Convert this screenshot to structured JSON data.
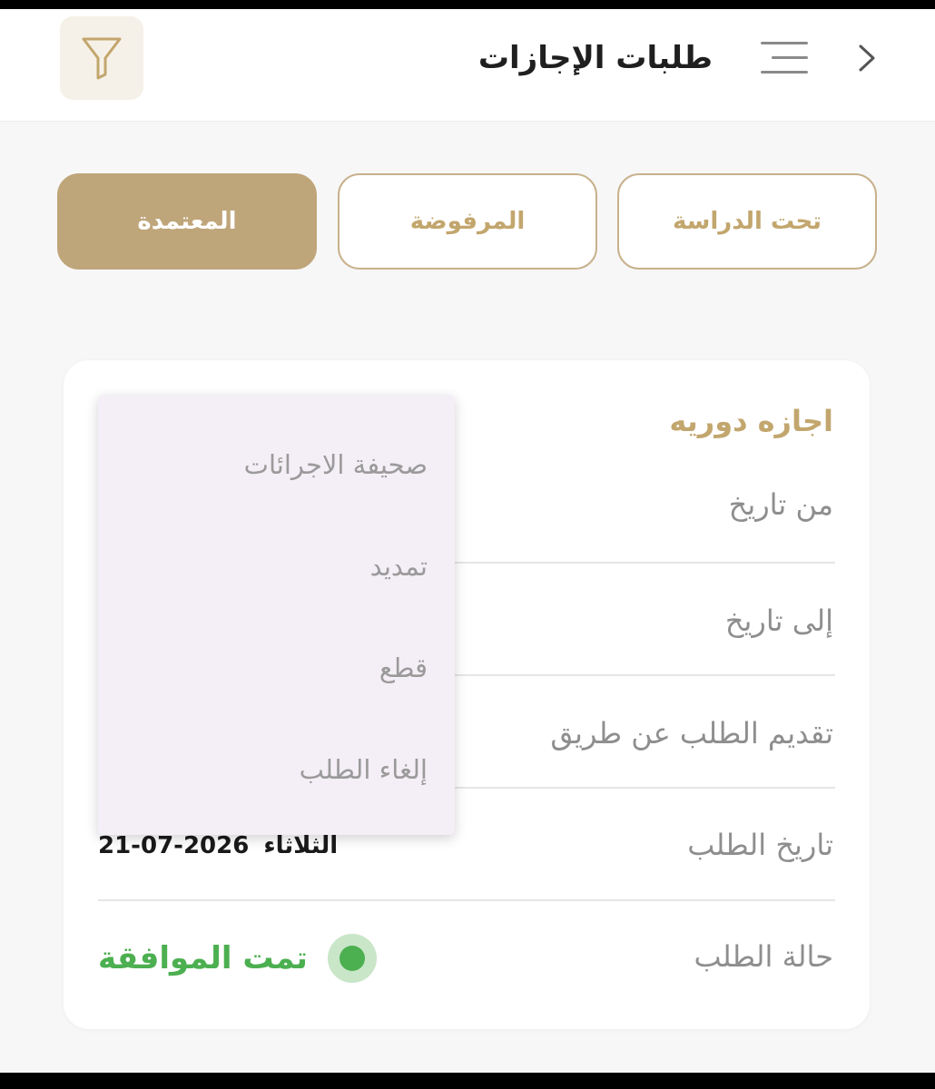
{
  "header": {
    "title": "طلبات الإجازات",
    "back_icon": "chevron-right-icon",
    "menu_icon": "menu-icon",
    "filter_icon": "filter-icon"
  },
  "tabs": [
    {
      "label": "تحت الدراسة",
      "active": false
    },
    {
      "label": "المرفوضة",
      "active": false
    },
    {
      "label": "المعتمدة",
      "active": true
    }
  ],
  "card": {
    "title": "اجازه دوريه",
    "rows": {
      "from_date_label": "من تاريخ",
      "to_date_label": "إلى تاريخ",
      "submitted_via_label": "تقديم الطلب عن طريق",
      "request_date_label": "تاريخ الطلب",
      "request_date_day": "الثلاثاء",
      "request_date_value": "21-07-2026",
      "status_label": "حالة الطلب",
      "status_value": "تمت الموافقة"
    }
  },
  "popup_menu": {
    "items": [
      {
        "label": "صحيفة الاجرائات"
      },
      {
        "label": "تمديد"
      },
      {
        "label": "قطع"
      },
      {
        "label": "إلغاء الطلب"
      }
    ]
  },
  "colors": {
    "accent_gold": "#bfa57a",
    "gold_text": "#c2a66d",
    "status_green": "#4caf50",
    "menu_bg": "#f4eef6"
  }
}
